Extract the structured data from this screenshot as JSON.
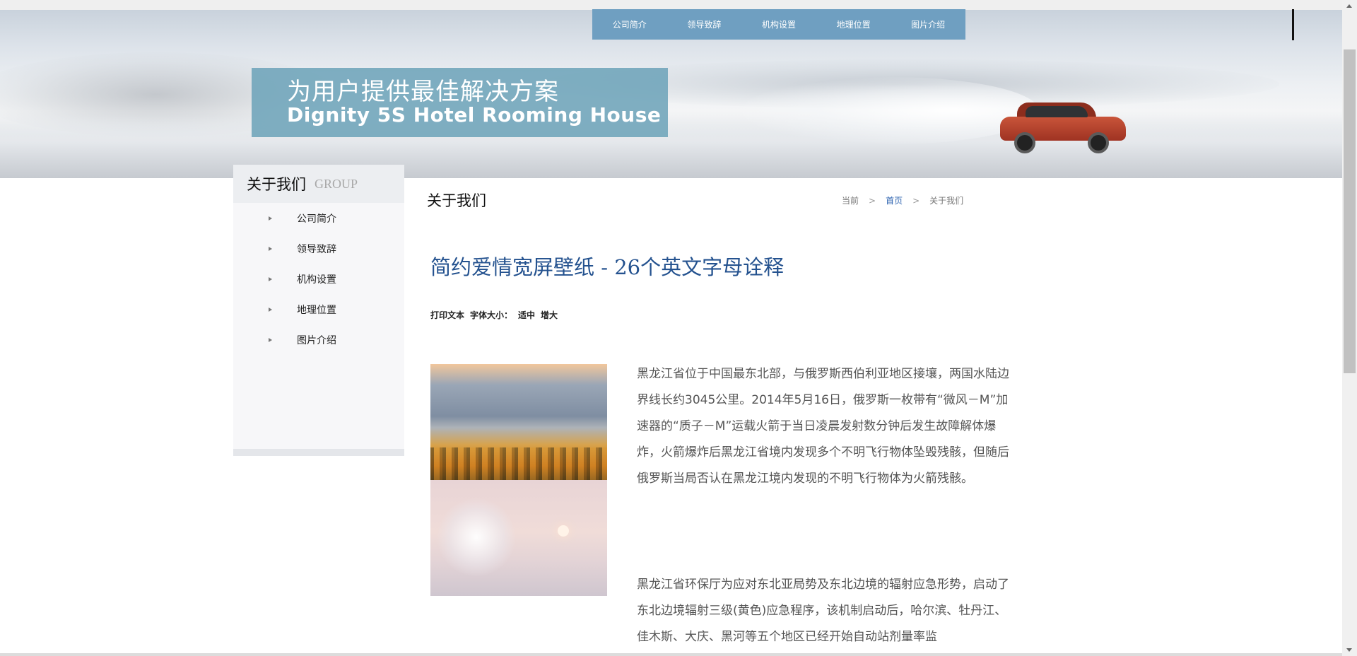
{
  "nav": {
    "items": [
      {
        "label": "公司简介"
      },
      {
        "label": "领导致辞"
      },
      {
        "label": "机构设置"
      },
      {
        "label": "地理位置"
      },
      {
        "label": "图片介绍"
      }
    ]
  },
  "banner": {
    "slogan_line1": "为用户提供最佳解决方案",
    "slogan_line2": "Dignity 5S Hotel Rooming House"
  },
  "sidebar": {
    "title": "关于我们",
    "title_en": "GROUP",
    "items": [
      {
        "label": "公司简介"
      },
      {
        "label": "领导致辞"
      },
      {
        "label": "机构设置"
      },
      {
        "label": "地理位置"
      },
      {
        "label": "图片介绍"
      }
    ]
  },
  "main": {
    "section_title": "关于我们",
    "breadcrumb": {
      "current_label": "当前",
      "separator": ">",
      "home": "首页",
      "page": "关于我们"
    },
    "article": {
      "title": "简约爱情宽屏壁纸 - 26个英文字母诠释",
      "tools": {
        "print": "打印文本",
        "font_size_label": "字体大小：",
        "medium": "适中",
        "large": "增大"
      },
      "paragraph1": "黑龙江省位于中国最东北部，与俄罗斯西伯利亚地区接壤，两国水陆边界线长约3045公里。2014年5月16日，俄罗斯一枚带有“微风－M”加速器的“质子－M”运载火箭于当日凌晨发射数分钟后发生故障解体爆炸，火箭爆炸后黑龙江省境内发现多个不明飞行物体坠毁残骸，但随后俄罗斯当局否认在黑龙江境内发现的不明飞行物体为火箭残骸。",
      "paragraph2": "黑龙江省环保厅为应对东北亚局势及东北边境的辐射应急形势，启动了东北边境辐射三级(黄色)应急程序，该机制启动后，哈尔滨、牡丹江、佳木斯、大庆、黑河等五个地区已经开始自动站剂量率监"
    }
  }
}
